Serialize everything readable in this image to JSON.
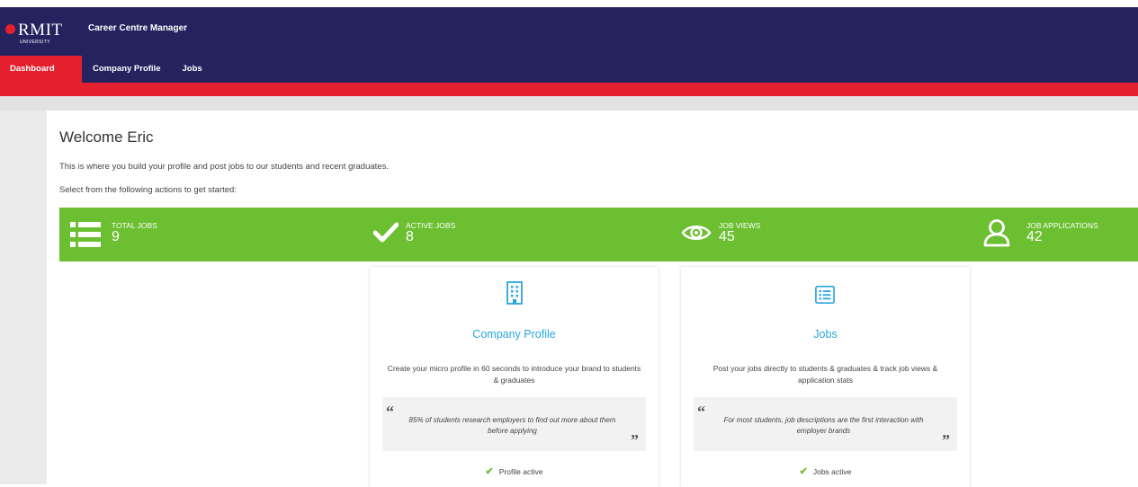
{
  "brand": {
    "name": "RMIT",
    "subname": "UNIVERSITY",
    "app_title": "Career Centre Manager"
  },
  "nav": {
    "items": [
      "Dashboard",
      "Company Profile",
      "Jobs"
    ],
    "active": "Dashboard"
  },
  "welcome": {
    "heading": "Welcome Eric",
    "line1": "This is where you build your profile and post jobs to our students and recent graduates.",
    "line2": "Select from the following actions to get started:"
  },
  "stats": [
    {
      "label": "TOTAL JOBS",
      "value": "9",
      "icon": "list-icon"
    },
    {
      "label": "ACTIVE JOBS",
      "value": "8",
      "icon": "checkmark-icon"
    },
    {
      "label": "JOB VIEWS",
      "value": "45",
      "icon": "eye-icon"
    },
    {
      "label": "JOB APPLICATIONS",
      "value": "42",
      "icon": "user-icon"
    }
  ],
  "cards": [
    {
      "title": "Company Profile",
      "icon": "building-icon",
      "description": "Create your micro profile in 60 seconds to introduce your brand to students & graduates",
      "quote": "85% of students research employers to find out more about them before applying",
      "status": "Profile active"
    },
    {
      "title": "Jobs",
      "icon": "list-box-icon",
      "description": "Post your jobs directly to students & graduates & track job views & application stats",
      "quote": "For most students, job descriptions are the first interaction with employer brands",
      "status": "Jobs active"
    }
  ],
  "colors": {
    "navy": "#24235f",
    "red": "#e5202e",
    "green": "#6cbf30",
    "blue": "#29a5dc"
  }
}
